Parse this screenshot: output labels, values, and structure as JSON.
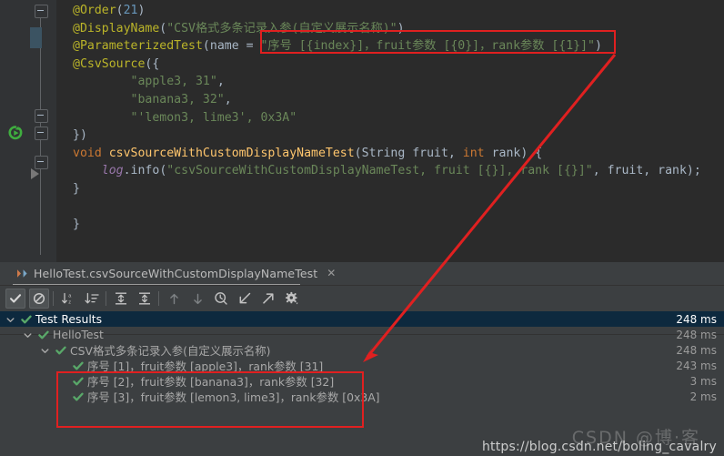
{
  "editor": {
    "background_color": "#2b2b2b",
    "lines": [
      {
        "id": "l1",
        "segments": [
          {
            "t": "@Order",
            "c": "ann"
          },
          {
            "t": "(",
            "c": "plain"
          },
          {
            "t": "21",
            "c": "num"
          },
          {
            "t": ")",
            "c": "plain"
          }
        ]
      },
      {
        "id": "l2",
        "segments": [
          {
            "t": "@DisplayName",
            "c": "ann"
          },
          {
            "t": "(",
            "c": "plain"
          },
          {
            "t": "\"CSV格式多条记录入参(自定义展示名称)\"",
            "c": "str"
          },
          {
            "t": ")",
            "c": "plain"
          }
        ]
      },
      {
        "id": "l3",
        "segments": [
          {
            "t": "@ParameterizedTest",
            "c": "ann"
          },
          {
            "t": "(",
            "c": "plain"
          },
          {
            "t": "name",
            "c": "id"
          },
          {
            "t": " = ",
            "c": "plain"
          },
          {
            "t": "\"序号 [{index}]，fruit参数 [{0}]，rank参数 [{1}]\"",
            "c": "str"
          },
          {
            "t": ")",
            "c": "plain"
          }
        ]
      },
      {
        "id": "l4",
        "segments": [
          {
            "t": "@CsvSource",
            "c": "ann"
          },
          {
            "t": "({",
            "c": "plain"
          }
        ]
      },
      {
        "id": "l5",
        "segments": [
          {
            "t": "        ",
            "c": "plain"
          },
          {
            "t": "\"apple3, 31\"",
            "c": "str"
          },
          {
            "t": ",",
            "c": "plain"
          }
        ]
      },
      {
        "id": "l6",
        "segments": [
          {
            "t": "        ",
            "c": "plain"
          },
          {
            "t": "\"banana3, 32\"",
            "c": "str"
          },
          {
            "t": ",",
            "c": "plain"
          }
        ]
      },
      {
        "id": "l7",
        "segments": [
          {
            "t": "        ",
            "c": "plain"
          },
          {
            "t": "\"'lemon3, lime3', 0x3A\"",
            "c": "str"
          }
        ]
      },
      {
        "id": "l8",
        "segments": [
          {
            "t": "})",
            "c": "plain"
          }
        ]
      },
      {
        "id": "l9",
        "segments": [
          {
            "t": "void",
            "c": "kw"
          },
          {
            "t": " ",
            "c": "plain"
          },
          {
            "t": "csvSourceWithCustomDisplayNameTest",
            "c": "mth"
          },
          {
            "t": "(",
            "c": "plain"
          },
          {
            "t": "String",
            "c": "id"
          },
          {
            "t": " fruit, ",
            "c": "plain"
          },
          {
            "t": "int",
            "c": "kw"
          },
          {
            "t": " rank) {",
            "c": "plain"
          }
        ]
      },
      {
        "id": "l10",
        "segments": [
          {
            "t": "    ",
            "c": "plain"
          },
          {
            "t": "log",
            "c": "fld"
          },
          {
            "t": ".",
            "c": "plain"
          },
          {
            "t": "info",
            "c": "plain"
          },
          {
            "t": "(",
            "c": "plain"
          },
          {
            "t": "\"csvSourceWithCustomDisplayNameTest, fruit [{}], rank [{}]\"",
            "c": "str"
          },
          {
            "t": ", fruit, rank);",
            "c": "plain"
          }
        ]
      },
      {
        "id": "l11",
        "segments": [
          {
            "t": "}",
            "c": "plain"
          }
        ]
      },
      {
        "id": "l12",
        "segments": [
          {
            "t": "",
            "c": "plain"
          }
        ]
      },
      {
        "id": "l13",
        "segments": [
          {
            "t": "}",
            "c": "plain"
          }
        ]
      }
    ]
  },
  "panel": {
    "tab": {
      "title": "HelloTest.csvSourceWithCustomDisplayNameTest",
      "close_label": "✕",
      "run_icon": "run-config-icon"
    },
    "toolbar": {
      "items": [
        {
          "name": "show-passed-toggle",
          "icon": "checkmark-icon",
          "active": true,
          "enabled": true
        },
        {
          "name": "show-ignored-toggle",
          "icon": "no-entry-icon",
          "active": true,
          "enabled": true
        },
        {
          "name": "sort-alphabetically",
          "icon": "sort-alpha-icon",
          "active": false,
          "enabled": true
        },
        {
          "name": "sort-by-duration",
          "icon": "sort-duration-icon",
          "active": false,
          "enabled": true
        },
        {
          "name": "expand-all",
          "icon": "expand-all-icon",
          "active": false,
          "enabled": true
        },
        {
          "name": "collapse-all",
          "icon": "collapse-all-icon",
          "active": false,
          "enabled": true
        },
        {
          "name": "previous-failed-test",
          "icon": "arrow-up-icon",
          "active": false,
          "enabled": false
        },
        {
          "name": "next-failed-test",
          "icon": "arrow-down-icon",
          "active": false,
          "enabled": false
        },
        {
          "name": "test-history",
          "icon": "history-clock-icon",
          "active": false,
          "enabled": true
        },
        {
          "name": "import-test-results",
          "icon": "import-icon",
          "active": false,
          "enabled": true
        },
        {
          "name": "export-test-results",
          "icon": "export-icon",
          "active": false,
          "enabled": true
        },
        {
          "name": "test-settings",
          "icon": "gear-icon",
          "active": false,
          "enabled": true
        }
      ]
    },
    "tree": [
      {
        "label": "Test Results",
        "duration": "248 ms",
        "depth": 0,
        "selected": true,
        "expandable": true,
        "status": "passed"
      },
      {
        "label": "HelloTest",
        "duration": "248 ms",
        "depth": 1,
        "selected": false,
        "expandable": true,
        "status": "passed"
      },
      {
        "label": "CSV格式多条记录入参(自定义展示名称)",
        "duration": "248 ms",
        "depth": 2,
        "selected": false,
        "expandable": true,
        "status": "passed"
      },
      {
        "label": "序号 [1]，fruit参数 [apple3]，rank参数 [31]",
        "duration": "243 ms",
        "depth": 3,
        "selected": false,
        "expandable": false,
        "status": "passed"
      },
      {
        "label": "序号 [2]，fruit参数 [banana3]，rank参数 [32]",
        "duration": "3 ms",
        "depth": 3,
        "selected": false,
        "expandable": false,
        "status": "passed"
      },
      {
        "label": "序号 [3]，fruit参数 [lemon3, lime3]，rank参数 [0x3A]",
        "duration": "2 ms",
        "depth": 3,
        "selected": false,
        "expandable": false,
        "status": "passed"
      }
    ]
  },
  "annotations": {
    "accent_color": "#e02020",
    "box_code_label": "highlighted-display-name-pattern",
    "box_results_label": "highlighted-generated-display-names",
    "arrow_label": "pattern-to-result-arrow"
  },
  "watermark": {
    "url": "https://blog.csdn.net/boling_cavalry",
    "overlay": "CSDN @博·客"
  }
}
